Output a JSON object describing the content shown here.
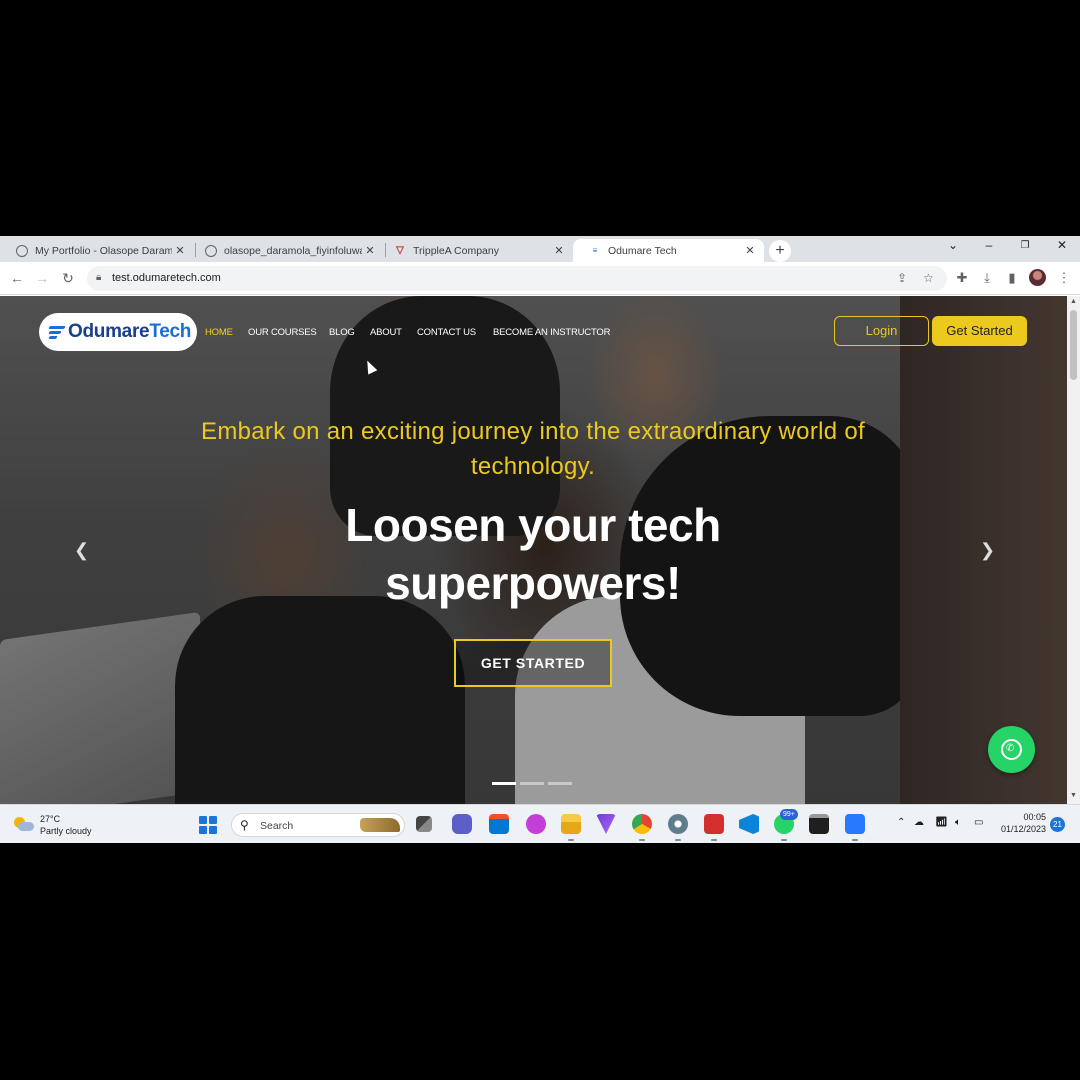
{
  "browser": {
    "tabs": [
      {
        "title": "My Portfolio - Olasope Daramola"
      },
      {
        "title": "olasope_daramola_fiyinfoluwa_c"
      },
      {
        "title": "TrippleA Company"
      },
      {
        "title": "Odumare Tech"
      }
    ],
    "new_tab": "+",
    "url": "test.odumaretech.com"
  },
  "site": {
    "logo": {
      "part1": "Odumare",
      "part2": "Tech"
    },
    "nav": [
      "HOME",
      "OUR COURSES",
      "BLOG",
      "ABOUT",
      "CONTACT US",
      "BECOME AN INSTRUCTOR"
    ],
    "login_label": "Login",
    "get_started_label": "Get Started",
    "hero": {
      "tagline": "Embark on an exciting journey into the extraordinary world of technology.",
      "headline_line1": "Loosen your tech",
      "headline_line2": "superpowers!",
      "cta": "GET STARTED"
    },
    "carousel_slides": 3,
    "carousel_active": 1
  },
  "taskbar": {
    "weather_temp": "27°C",
    "weather_desc": "Partly cloudy",
    "search_placeholder": "Search",
    "whatsapp_badge": "99+",
    "time": "00:05",
    "date": "01/12/2023",
    "notifications": "21"
  },
  "colors": {
    "accent_yellow": "#ecc91f",
    "brand_blue": "#1a6ed8",
    "whatsapp_green": "#25d366"
  }
}
